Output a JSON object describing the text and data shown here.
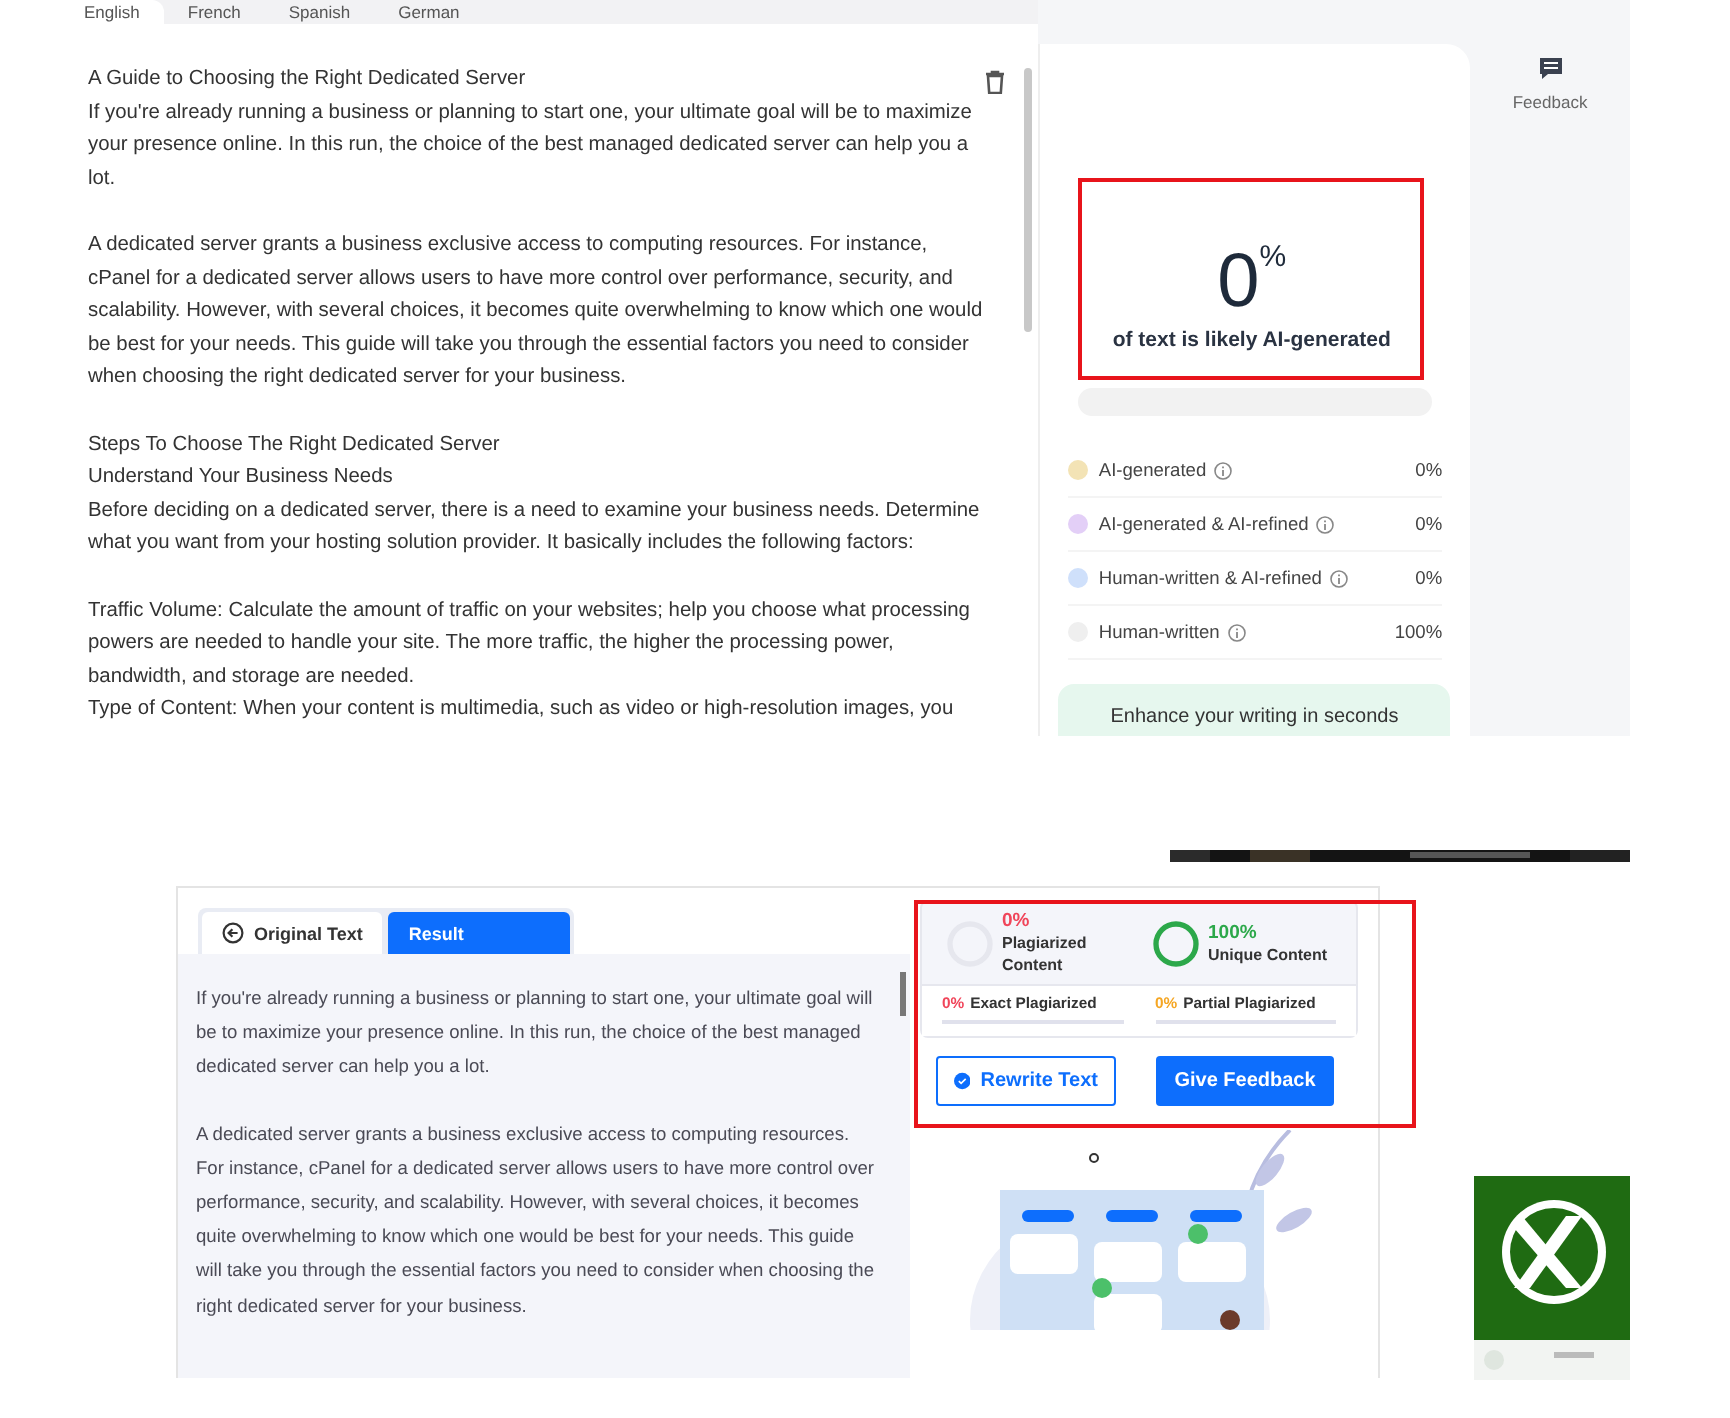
{
  "detector": {
    "tabs": [
      {
        "label": "English",
        "selected": true
      },
      {
        "label": "French",
        "selected": false
      },
      {
        "label": "Spanish",
        "selected": false
      },
      {
        "label": "German",
        "selected": false
      }
    ],
    "document": {
      "paragraphs": [
        [
          "A Guide to Choosing the Right Dedicated Server",
          "If you're already running a business or planning to start one, your ultimate goal will be to maximize your presence online. In this run, the choice of the best managed dedicated server can help you a lot."
        ],
        [
          "A dedicated server grants a business exclusive access to computing resources. For instance, cPanel for a dedicated server allows users to have more control over performance, security, and scalability. However, with several choices, it becomes quite overwhelming to know which one would be best for your needs. This guide will take you through the essential factors you need to consider when choosing the right dedicated server for your business."
        ],
        [
          "Steps To Choose The Right Dedicated Server",
          "Understand Your Business Needs",
          "Before deciding on a dedicated server, there is a need to examine your business needs. Determine what you want from your hosting solution provider. It basically includes the following factors:"
        ],
        [
          "Traffic Volume: Calculate the amount of traffic on your websites; help you choose what processing powers are needed to handle your site. The more traffic, the higher the processing power, bandwidth, and storage are needed.",
          "Type of Content: When your content is multimedia, such as video or high-resolution images, you"
        ]
      ]
    },
    "score": {
      "value": "0",
      "unit": "%",
      "caption": "of text is likely AI-generated"
    },
    "categories": [
      {
        "label": "AI-generated",
        "color": "#f3e3b5",
        "value": "0%"
      },
      {
        "label": "AI-generated & AI-refined",
        "color": "#e3cff7",
        "value": "0%"
      },
      {
        "label": "Human-written & AI-refined",
        "color": "#cfe0fb",
        "value": "0%"
      },
      {
        "label": "Human-written",
        "color": "#efefef",
        "value": "100%"
      }
    ],
    "promo": "Enhance your writing in seconds",
    "side": {
      "feedback": "Feedback"
    }
  },
  "checker": {
    "tabs": [
      {
        "label": "Original Text",
        "selected": false,
        "kind": "back"
      },
      {
        "label": "Result",
        "selected": true,
        "kind": "plain"
      }
    ],
    "paragraphs": [
      "If you're already running a business or planning to start one, your ultimate goal will be to maximize your presence online. In this run, the choice of the best managed dedicated server can help you a lot.",
      "A dedicated server grants a business exclusive access to computing resources. For instance, cPanel for a dedicated server allows users to have more control over performance, security, and scalability. However, with several choices, it becomes quite overwhelming to know which one would be best for your needs. This guide will take you through the essential factors you need to consider when choosing the right dedicated server for your business."
    ],
    "rings": [
      {
        "value": "0%",
        "label": "Plagiarized Content",
        "color": "#f0455a",
        "complete": false
      },
      {
        "value": "100%",
        "label": "Unique Content",
        "color": "#2ca84a",
        "complete": true
      }
    ],
    "breakdown": [
      {
        "value": "0%",
        "label": "Exact Plagiarized",
        "color": "#f0455a"
      },
      {
        "value": "0%",
        "label": "Partial Plagiarized",
        "color": "#f5a623"
      }
    ],
    "buttons": [
      {
        "label": "Rewrite Text",
        "kind": "outline"
      },
      {
        "label": "Give Feedback",
        "kind": "filled"
      }
    ]
  }
}
